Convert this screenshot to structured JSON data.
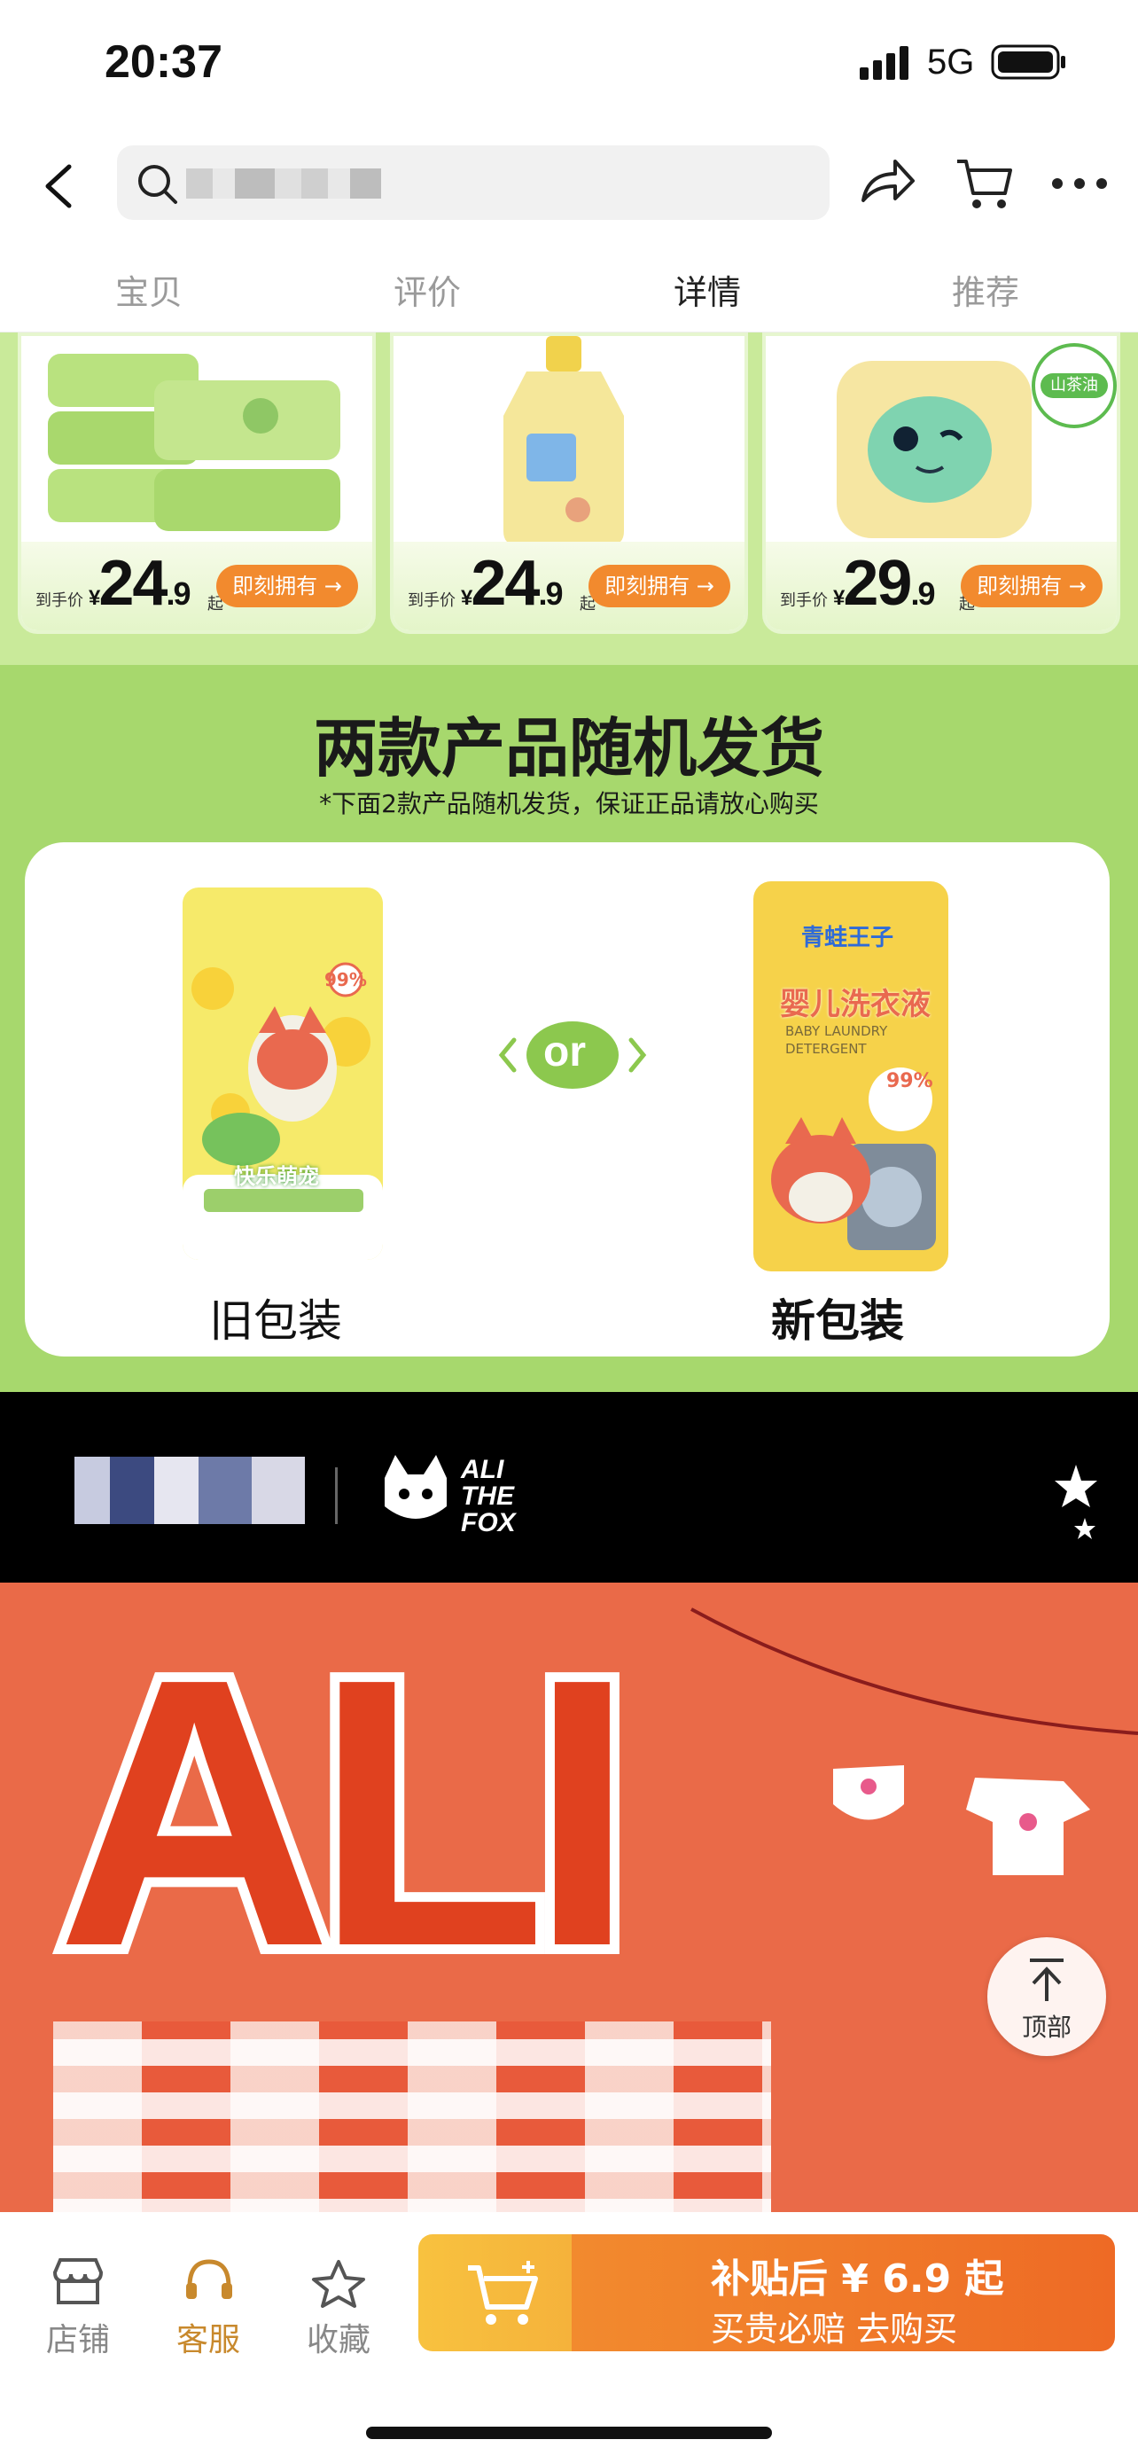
{
  "status_bar": {
    "time": "20:37",
    "network": "5G"
  },
  "nav": {
    "search_placeholder": ""
  },
  "tabs": [
    "宝贝",
    "评价",
    "详情",
    "推荐"
  ],
  "active_tab_index": 2,
  "promo_cards": [
    {
      "label": "到手价",
      "currency": "¥",
      "price_int": "24",
      "price_dec": ".9",
      "suffix": "起",
      "button": "即刻拥有 →"
    },
    {
      "label": "到手价",
      "currency": "¥",
      "price_int": "24",
      "price_dec": ".9",
      "suffix": "起",
      "button": "即刻拥有 →"
    },
    {
      "label": "到手价",
      "currency": "¥",
      "price_int": "29",
      "price_dec": ".9",
      "suffix": "起",
      "button": "即刻拥有 →",
      "badge": "山茶油"
    }
  ],
  "section": {
    "title": "两款产品随机发货",
    "subtitle": "*下面2款产品随机发货，保证正品请放心购买",
    "or": "or",
    "old_label": "旧包装",
    "new_label": "新包装",
    "new_pkg_brand": "青蛙王子",
    "new_pkg_name": "婴儿洗衣液",
    "new_pkg_en": "BABY LAUNDRY DETERGENT",
    "old_pkg_name": "快乐萌宠",
    "percent": "99%"
  },
  "brand_bar": {
    "logo_text": [
      "ALI",
      "THE",
      "FOX"
    ]
  },
  "banner": {
    "word": "ALI"
  },
  "to_top": {
    "label": "顶部"
  },
  "bottom_bar": {
    "items": [
      {
        "label": "店铺"
      },
      {
        "label": "客服"
      },
      {
        "label": "收藏"
      }
    ],
    "buy_line1": "补贴后 ¥ 6.9 起",
    "buy_line2": "买贵必赔  去购买"
  },
  "colors": {
    "accent_orange": "#f28a2e",
    "green": "#a7d86d",
    "banner_red": "#ea6a48",
    "service_gold": "#c8892d"
  }
}
